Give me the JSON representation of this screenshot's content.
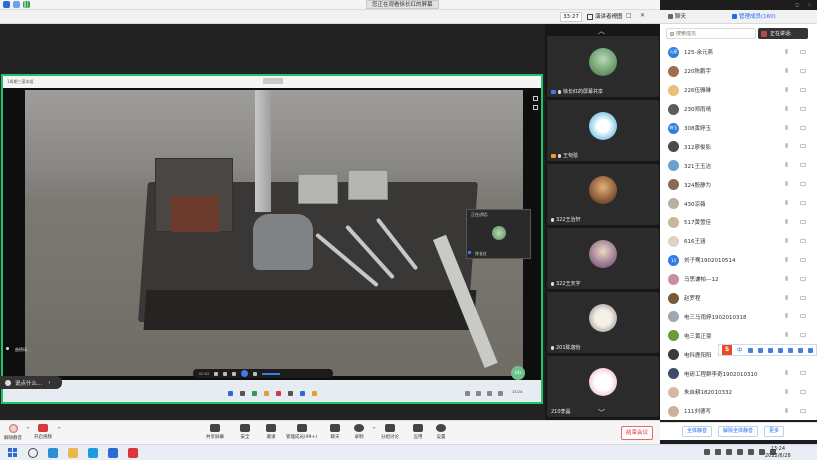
{
  "top": {
    "share_title": "您正在观看徐长红的屏幕",
    "timer": "33:27",
    "view_label": "演讲者视图",
    "controls": [
      "—",
      "□",
      "✕"
    ]
  },
  "screen": {
    "mini_label": "1周期三基本组",
    "pip_label": "正在讲话:",
    "pip_name": "徐长红",
    "player_time": "00:02",
    "sub_label": "曲德研...",
    "tray_time": "13:24",
    "pct": "44s"
  },
  "remote_note": {
    "label": "说点什么..."
  },
  "gallery": {
    "tiles": [
      {
        "name": "徐长红的屏幕共享",
        "host": true,
        "org": false
      },
      {
        "name": "王甸弦",
        "host": false,
        "org": true
      },
      {
        "name": "322王治轩",
        "host": false,
        "org": false
      },
      {
        "name": "322王天宇",
        "host": false,
        "org": false
      },
      {
        "name": "201陈迦怡",
        "host": false,
        "org": false
      },
      {
        "name": "210李晶",
        "host": false,
        "org": false
      }
    ]
  },
  "panel": {
    "tab_chat": "聊天",
    "tab_members": "管理成员(160)",
    "search_placeholder": "搜索成员",
    "speaking": "正在讲话:",
    "members": [
      {
        "name": "125-余元燕",
        "badge": "元燕",
        "color": "#2f7de1"
      },
      {
        "name": "220陈鹏宇",
        "badge": "",
        "color": "#a06c52"
      },
      {
        "name": "226伍雅琳",
        "badge": "",
        "color": "#e8c07a"
      },
      {
        "name": "230郑雨晴",
        "badge": "",
        "color": "#5c5c5c"
      },
      {
        "name": "308黄婷玉",
        "badge": "婷玉",
        "color": "#2f7de1"
      },
      {
        "name": "312廖俊影",
        "badge": "",
        "color": "#4a4a4a"
      },
      {
        "name": "321王玉洁",
        "badge": "",
        "color": "#6e9fd1"
      },
      {
        "name": "324殷静为",
        "badge": "",
        "color": "#8a6a5a"
      },
      {
        "name": "430凉薇",
        "badge": "",
        "color": "#b8b0a4"
      },
      {
        "name": "517黄雪佳",
        "badge": "",
        "color": "#c8b89a"
      },
      {
        "name": "616王涵",
        "badge": "",
        "color": "#e0d2c0"
      },
      {
        "name": "刘子骞1902010514",
        "badge": "14",
        "color": "#2f7de1"
      },
      {
        "name": "马思谦帕—12",
        "badge": "",
        "color": "#c98f9f"
      },
      {
        "name": "赵罗程",
        "badge": "",
        "color": "#7a5a3a"
      },
      {
        "name": "电三马雨婷1902010318",
        "badge": "",
        "color": "#9fa7b0"
      },
      {
        "name": "电三黄正豪",
        "badge": "",
        "color": "#6a9b3a"
      },
      {
        "name": "电科鹿阳阳",
        "badge": "",
        "color": "#3a3a3a"
      },
      {
        "name": "电研工程群李奇1902010310",
        "badge": "",
        "color": "#3f4b6a"
      },
      {
        "name": "朱自耕182010332",
        "badge": "",
        "color": "#d6b8a8"
      },
      {
        "name": "111刘德写",
        "badge": "",
        "color": "#c9b29a"
      }
    ],
    "ime_label": "中",
    "footer": {
      "mute_all": "全体静音",
      "unmute_all": "解除全体静音",
      "more": "更多"
    }
  },
  "controls": {
    "mute": "解除静音",
    "video": "开启视频",
    "share": "共享屏幕",
    "security": "安全",
    "invite": "邀请",
    "members": "管理成员(99+)",
    "chat": "聊天",
    "record": "录制",
    "breakout": "分组讨论",
    "apps": "应用",
    "settings": "设置",
    "leave": "结束会议"
  },
  "taskbar": {
    "time": "13:24",
    "date": "2022/6/28"
  },
  "colors": {
    "accent": "#1f6bf0",
    "share_border": "#21c06a",
    "leave": "#d9363e"
  }
}
